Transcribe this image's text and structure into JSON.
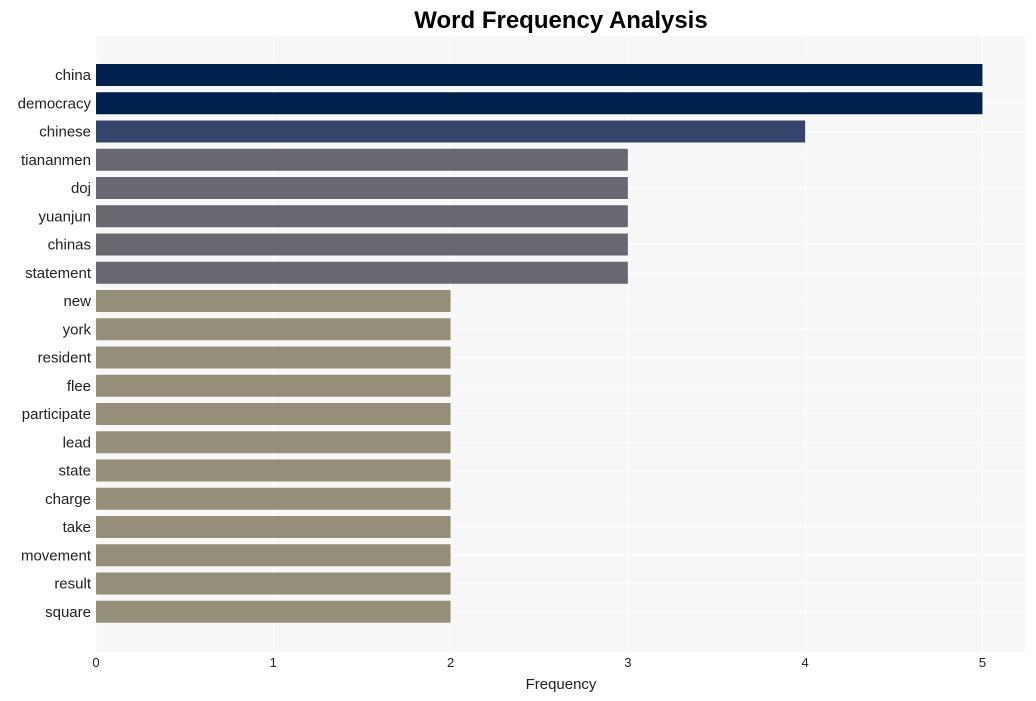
{
  "chart_data": {
    "type": "bar",
    "orientation": "horizontal",
    "title": "Word Frequency Analysis",
    "xlabel": "Frequency",
    "ylabel": "",
    "xlim": [
      0,
      5.24
    ],
    "xticks": [
      0,
      1,
      2,
      3,
      4,
      5
    ],
    "grid": true,
    "categories": [
      "china",
      "democracy",
      "chinese",
      "tiananmen",
      "doj",
      "yuanjun",
      "chinas",
      "statement",
      "new",
      "york",
      "resident",
      "flee",
      "participate",
      "lead",
      "state",
      "charge",
      "take",
      "movement",
      "result",
      "square"
    ],
    "values": [
      5,
      5,
      4,
      3,
      3,
      3,
      3,
      3,
      2,
      2,
      2,
      2,
      2,
      2,
      2,
      2,
      2,
      2,
      2,
      2
    ],
    "colors_by_value": {
      "5": "#00204e",
      "4": "#35446b",
      "3": "#676870",
      "2": "#958f79"
    }
  },
  "colors": {
    "plot_background": "#f7f7f7",
    "grid": "#ffffff"
  }
}
